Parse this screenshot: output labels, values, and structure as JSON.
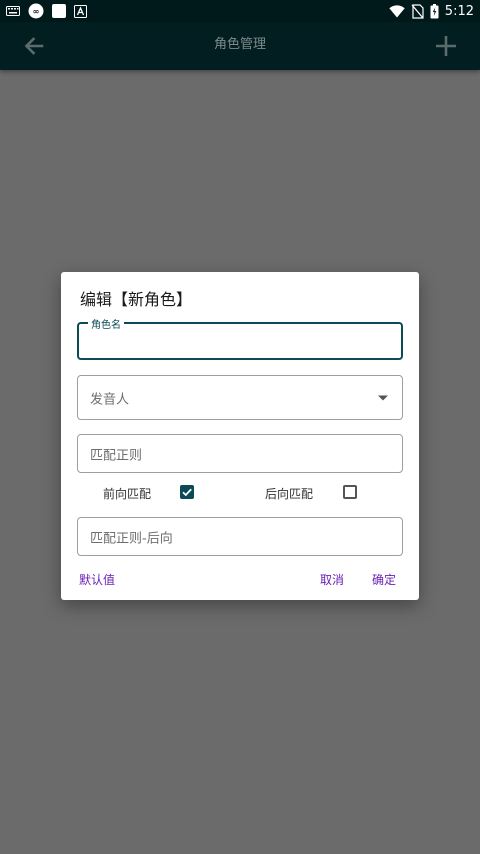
{
  "status_bar": {
    "time": "5:12",
    "icons": [
      "keyboard-icon",
      "cloud-app-icon",
      "white-square-app-icon",
      "a-letter-app-icon",
      "wifi-icon",
      "no-sim-icon",
      "battery-icon"
    ]
  },
  "app_bar": {
    "title": "角色管理",
    "icons": [
      "back-arrow-icon",
      "plus-icon"
    ]
  },
  "dialog": {
    "title": "编辑【新角色】",
    "role_name": {
      "label": "角色名",
      "value": ""
    },
    "speaker": {
      "placeholder": "发音人"
    },
    "regex": {
      "placeholder": "匹配正则"
    },
    "forward_match": {
      "label": "前向匹配",
      "checked": true
    },
    "backward_match": {
      "label": "后向匹配",
      "checked": false
    },
    "regex_backward": {
      "placeholder": "匹配正则-后向"
    },
    "buttons": {
      "default": "默认值",
      "cancel": "取消",
      "confirm": "确定"
    }
  },
  "colors": {
    "accent": "#0c4a56",
    "button_text": "#6a1fb5",
    "scrim": "#6b6b6b",
    "app_bar": "#021e21"
  }
}
